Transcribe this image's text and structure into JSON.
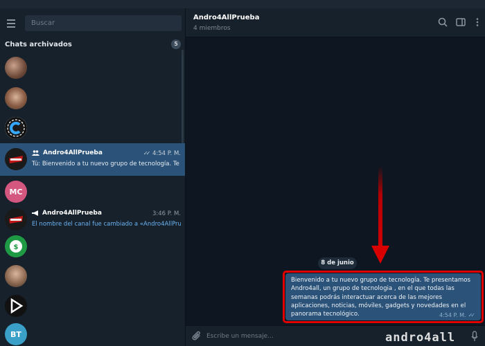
{
  "sidebar": {
    "search_placeholder": "Buscar",
    "archived_title": "Chats archivados",
    "archived_count": "5",
    "chats": [
      {
        "title": "Andro4AllPrueba",
        "time": "4:54 P. M.",
        "preview": "Tú: Bienvenido a tu nuevo grupo de tecnología. Te presentamos",
        "icon": "group-icon"
      },
      {
        "avatar_initials": "MC",
        "avatar_color": "#d4577f"
      },
      {
        "title": "Andro4AllPrueba",
        "time": "3:46 P. M.",
        "preview": "El nombre del canal fue cambiado a «Andro4AllPrueba»",
        "icon": "megaphone-icon"
      },
      {
        "avatar_initials": "BT",
        "avatar_color": "#3aa0c8"
      }
    ]
  },
  "chat": {
    "title": "Andro4AllPrueba",
    "subtitle": "4 miembros",
    "date_label": "8 de junio",
    "message": {
      "text": "Bienvenido a tu nuevo grupo de tecnología. Te presentamos Andro4all, un grupo de tecnologia , en el que todas las semanas podrás interactuar acerca de las mejores aplicaciones, noticias, móviles, gadgets y novedades en el panorama tecnológico.",
      "time": "4:54 P. M."
    },
    "composer_placeholder": "Escribe un mensaje..."
  },
  "watermark": "andro4all",
  "colors": {
    "accent": "#2b5278",
    "highlight": "#e00000",
    "link": "#6ab3f3"
  }
}
